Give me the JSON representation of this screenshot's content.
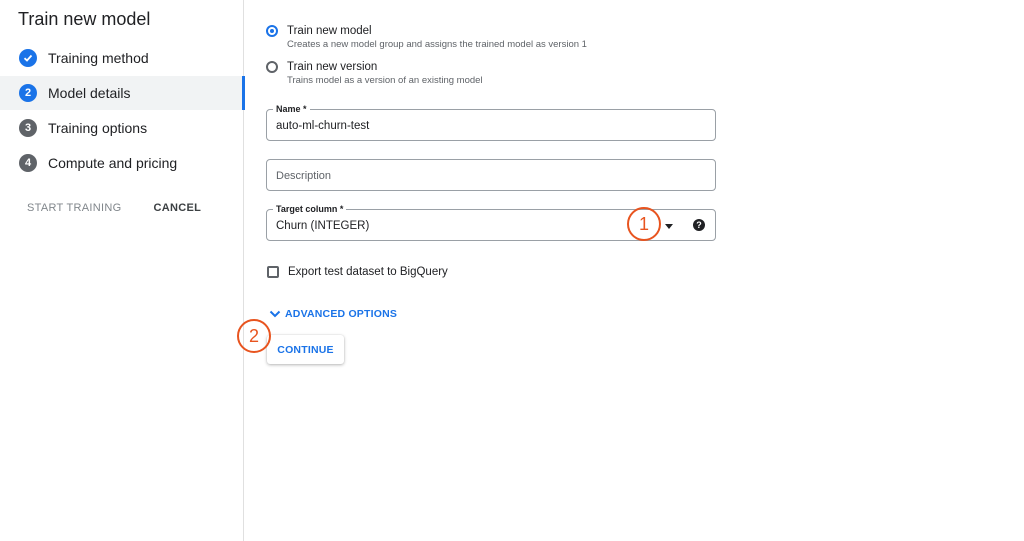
{
  "sidebar": {
    "title": "Train new model",
    "steps": [
      {
        "number": "✓",
        "label": "Training method",
        "state": "done"
      },
      {
        "number": "2",
        "label": "Model details",
        "state": "current"
      },
      {
        "number": "3",
        "label": "Training options",
        "state": "pending"
      },
      {
        "number": "4",
        "label": "Compute and pricing",
        "state": "pending"
      }
    ],
    "start_training_label": "START TRAINING",
    "cancel_label": "CANCEL"
  },
  "options": {
    "train_new_model": {
      "label": "Train new model",
      "description": "Creates a new model group and assigns the trained model as version 1",
      "selected": true
    },
    "train_new_version": {
      "label": "Train new version",
      "description": "Trains model as a version of an existing model",
      "selected": false
    }
  },
  "name_field": {
    "legend": "Name *",
    "value": "auto-ml-churn-test"
  },
  "description_field": {
    "placeholder": "Description"
  },
  "target_column": {
    "legend": "Target column *",
    "value": "Churn (INTEGER)",
    "help_icon": "?"
  },
  "export_checkbox": {
    "label": "Export test dataset to BigQuery",
    "checked": false
  },
  "advanced_options_label": "ADVANCED OPTIONS",
  "continue_label": "CONTINUE",
  "callouts": [
    "1",
    "2"
  ],
  "colors": {
    "accent": "#1a73e8",
    "callout": "#e8541f"
  }
}
